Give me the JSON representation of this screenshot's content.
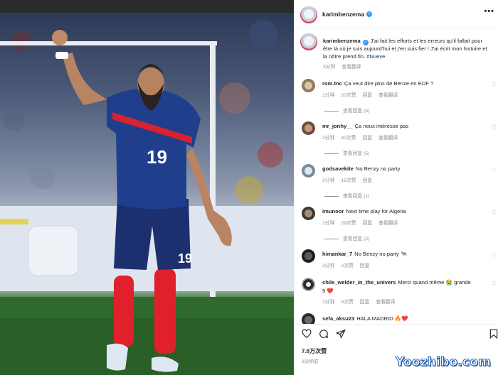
{
  "post": {
    "username": "karimbenzema",
    "caption": "J'ai fait les efforts et les erreurs qu'il fallait pour être là où je suis aujourd'hui et j'en suis fier ! J'ai écrit mon histoire et la nôtre prend fin.",
    "hashtag": "#Nueve",
    "caption_time": "3分钟",
    "caption_translate": "查看翻译",
    "likes": "7.6万次赞",
    "post_time": "3分钟前"
  },
  "comments": [
    {
      "user": "rom.tnc",
      "text": "Ça veut dire plus de Benze en EDF ?",
      "time": "2分钟",
      "likes": "20次赞",
      "reply": "回复",
      "translate": "查看翻译",
      "replies": "查看回复 (5)"
    },
    {
      "user": "mr_jonhy__",
      "text": "Ça nous intéresse pas",
      "time": "2分钟",
      "likes": "40次赞",
      "reply": "回复",
      "translate": "查看翻译",
      "replies": "查看回复 (5)"
    },
    {
      "user": "godsavekite",
      "text": "No Benzy no party",
      "time": "2分钟",
      "likes": "16次赞",
      "reply": "回复",
      "replies": "查看回复 (1)"
    },
    {
      "user": "imunoor",
      "text": "Next time play for Algeria",
      "time": "2分钟",
      "likes": "29次赞",
      "reply": "回复",
      "translate": "查看翻译",
      "replies": "查看回复 (2)"
    },
    {
      "user": "himankar_7",
      "text": "No Benzy no party 🐄",
      "time": "2分钟",
      "likes": "2次赞",
      "reply": "回复"
    },
    {
      "user": "chile_welder_in_the_univers",
      "text": "Merci quand même 😭 grande",
      "text2": "9 ❤️",
      "time": "2分钟",
      "likes": "3次赞",
      "reply": "回复",
      "translate": "查看翻译"
    },
    {
      "user": "sefa_aksu23",
      "text": "HALA MADRID 🔥❤️"
    }
  ],
  "player": {
    "number": "19"
  },
  "watermark": "Yoozhibo.com",
  "icons": [
    "heart-icon",
    "comment-icon",
    "share-icon",
    "bookmark-icon",
    "more-icon",
    "verified-icon"
  ],
  "colors": {
    "verified": "#3897f0",
    "hashtag": "#00376b",
    "meta": "#8e8e8e",
    "jersey": "#1f3f8c",
    "sock": "#e0202a"
  }
}
